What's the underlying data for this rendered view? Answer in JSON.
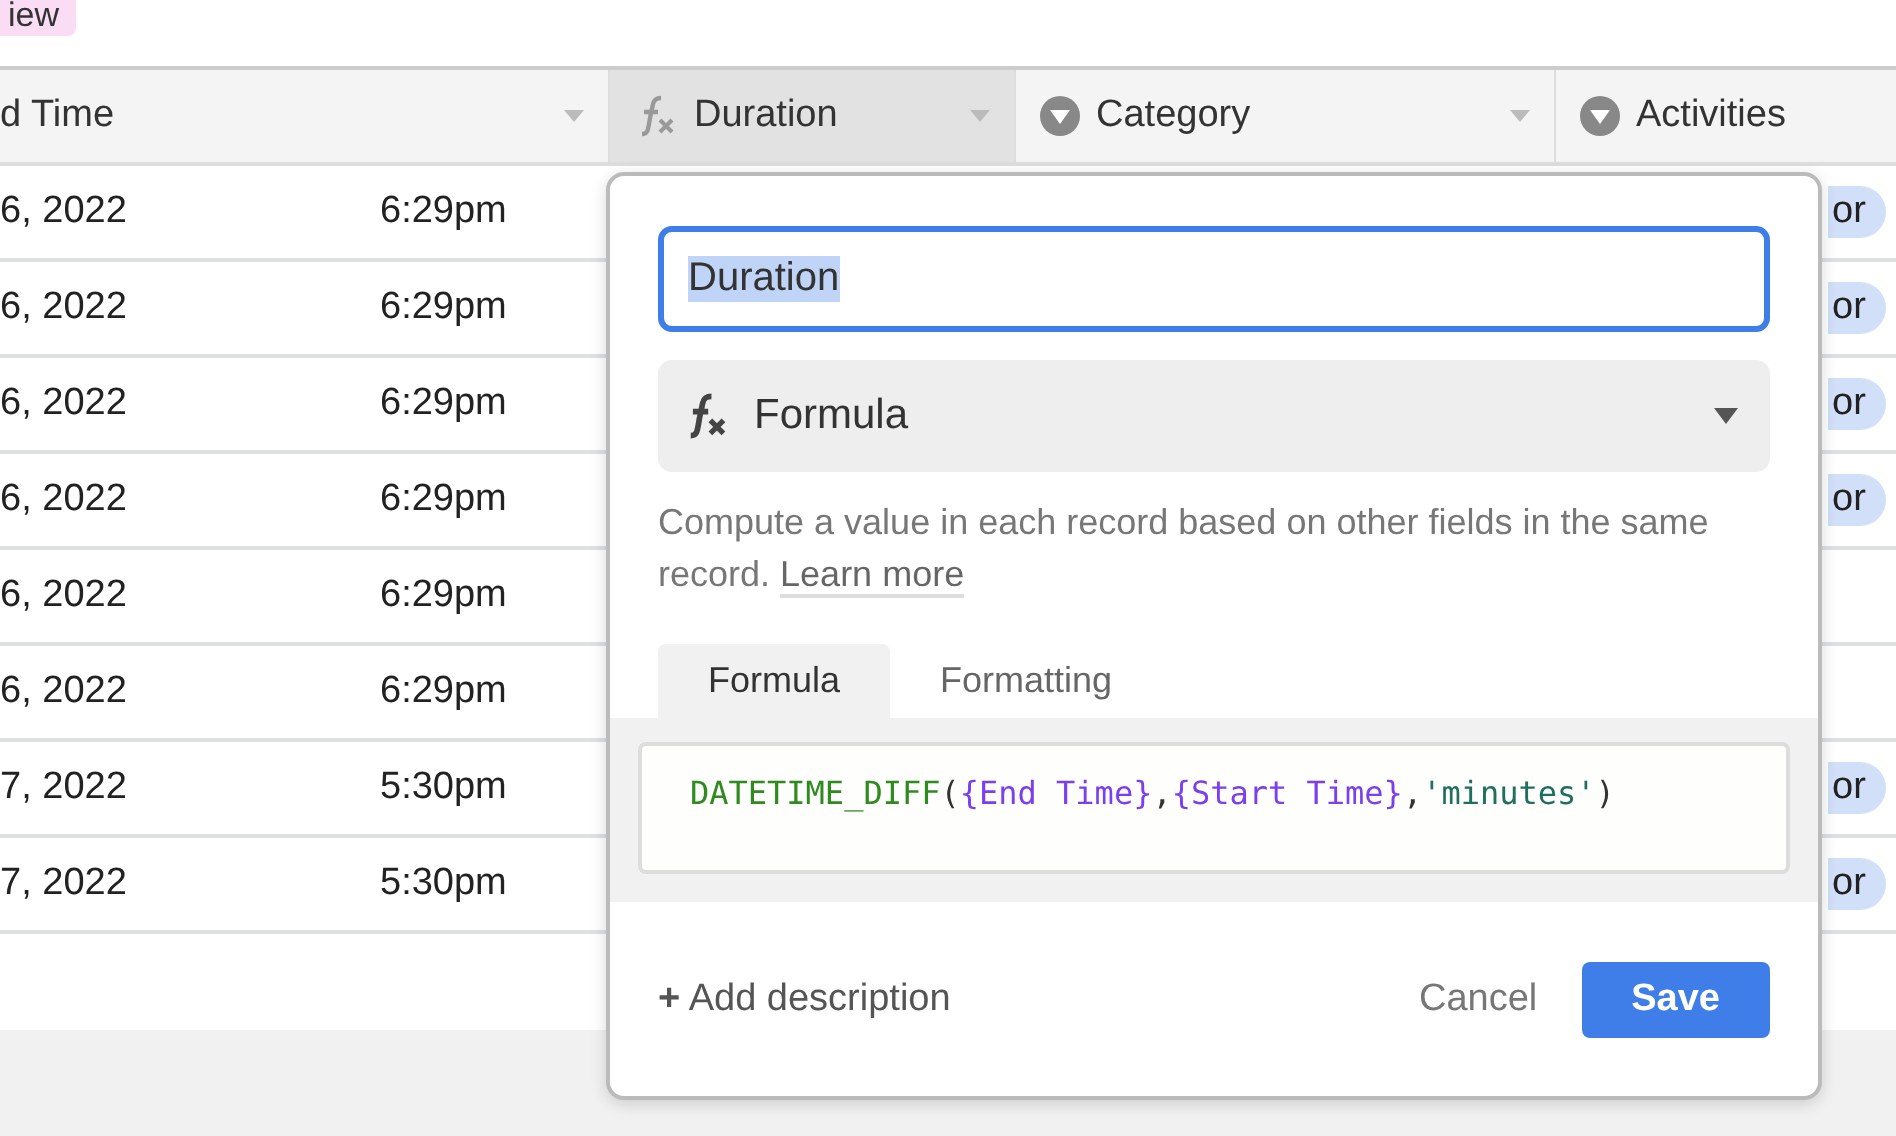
{
  "view_badge": {
    "label": "iew"
  },
  "table": {
    "columns": [
      {
        "label": "d Time",
        "kind": "datetime",
        "selected": false
      },
      {
        "label": "Duration",
        "kind": "formula",
        "selected": true
      },
      {
        "label": "Category",
        "kind": "select",
        "selected": false
      },
      {
        "label": "Activities",
        "kind": "select",
        "selected": false
      }
    ],
    "rows": [
      {
        "date": "6, 2022",
        "time": "6:29pm",
        "activity": "or"
      },
      {
        "date": "6, 2022",
        "time": "6:29pm",
        "activity": "or"
      },
      {
        "date": "6, 2022",
        "time": "6:29pm",
        "activity": "or"
      },
      {
        "date": "6, 2022",
        "time": "6:29pm",
        "activity": "or"
      },
      {
        "date": "6, 2022",
        "time": "6:29pm"
      },
      {
        "date": "6, 2022",
        "time": "6:29pm"
      },
      {
        "date": "7, 2022",
        "time": "5:30pm",
        "activity": "or"
      },
      {
        "date": "7, 2022",
        "time": "5:30pm",
        "activity": "or"
      }
    ]
  },
  "field_editor": {
    "name_value": "Duration",
    "type_label": "Formula",
    "description": "Compute a value in each record based on other fields in the same record.",
    "learn_more": "Learn more",
    "tabs": [
      {
        "label": "Formula",
        "selected": true
      },
      {
        "label": "Formatting",
        "selected": false
      }
    ],
    "formula": [
      {
        "kind": "function",
        "text": "DATETIME_DIFF"
      },
      {
        "kind": "punct",
        "text": "("
      },
      {
        "kind": "field",
        "text": "{End Time}"
      },
      {
        "kind": "punct",
        "text": ","
      },
      {
        "kind": "field",
        "text": "{Start Time}"
      },
      {
        "kind": "punct",
        "text": ","
      },
      {
        "kind": "string",
        "text": "'minutes'"
      },
      {
        "kind": "punct",
        "text": ")"
      }
    ],
    "add_description": "Add description",
    "add_icon": "+",
    "cancel": "Cancel",
    "save": "Save"
  }
}
